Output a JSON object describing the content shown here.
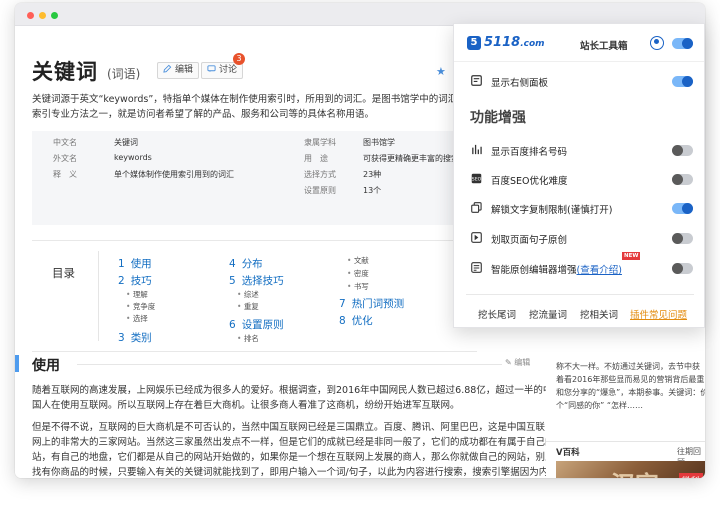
{
  "article": {
    "title": "关键词",
    "title_sub": "(词语)",
    "edit_label": "编辑",
    "discuss_label": "讨论",
    "discuss_count": "3",
    "intro_line1": "关键词源于英文“keywords”，特指单个媒体在制作使用索引时，所用到的词汇。是图书馆学中的词汇。关",
    "intro_line2": "索引专业方法之一，就是访问者希望了解的产品、服务和公司等的具体名称用语。"
  },
  "infobox": {
    "left": [
      {
        "label": "中文名",
        "value": "关键词"
      },
      {
        "label": "外文名",
        "value": "keywords"
      },
      {
        "label": "释　义",
        "value": "单个媒体制作使用索引用到的词汇"
      }
    ],
    "right": [
      {
        "label": "隶属学科",
        "value": "图书馆学"
      },
      {
        "label": "用　途",
        "value": "可获得更精确更丰富的搜索结果"
      },
      {
        "label": "选择方式",
        "value": "23种"
      },
      {
        "label": "设置原则",
        "value": "13个"
      }
    ]
  },
  "toc": {
    "title": "目录",
    "col1": [
      {
        "num": "1",
        "label": "使用"
      },
      {
        "num": "2",
        "label": "技巧"
      },
      {
        "num": "3",
        "label": "类别"
      }
    ],
    "col1_subs": [
      "理解",
      "竞争度",
      "选择"
    ],
    "col2": [
      {
        "num": "4",
        "label": "分布"
      },
      {
        "num": "5",
        "label": "选择技巧"
      },
      {
        "num": "6",
        "label": "设置原则"
      }
    ],
    "col2_subs": [
      "综述",
      "重复"
    ],
    "col2_subs_b": [
      "排名"
    ],
    "col3_subs": [
      "文献",
      "密度",
      "书写"
    ],
    "col3": [
      {
        "num": "7",
        "label": "热门词预测"
      },
      {
        "num": "8",
        "label": "优化"
      }
    ]
  },
  "section": {
    "title": "使用",
    "edit_label": "编辑",
    "para1_line1": "随着互联网的高速发展，上网娱乐已经成为很多人的爱好。根据调查，到2016年中国网民人数已超过6.88亿，超过一半的中",
    "para1_line2": "国人在使用互联网。所以互联网上存在着巨大商机。让很多商人看准了这商机，纷纷开始进军互联网。",
    "para2_line1": "但是不得不说，互联网的巨大商机是不可否认的，当然中国互联网已经是三国鼎立。百度、腾讯、阿里巴巴，这是中国互联",
    "para2_line2": "网上的非常大的三家网站。当然这三家虽然出发点不一样，但是它们的成就已经是非同一般了，它们的成功都在有属于自己的网",
    "para2_line3": "站，有自己的地盘，它们都是从自己的网站开始做的，如果你是一个想在互联网上发展的商人，那么你就做自己的网站，别人在",
    "para2_line4": "找有你商品的时候，只要输入有关的关键词就能找到了，即用户输入一个词/句子，以此为内容进行搜索，搜索引擎据因为内容是"
  },
  "right_col": {
    "line1": "称不大一样。不妨通过关键词，去节中获",
    "line2": "着看2016年那些显而易见的营销背后最重",
    "line3": "和您分享的“爆急”，本期参事。关键词：价",
    "line4": "个“同感的你” “怎样……",
    "vbaike_title": "V百科",
    "vbaike_more": "往期回顾",
    "vbaike_big": "汉字",
    "vbaike_tag": "微科"
  },
  "popup": {
    "logo_text": "5118",
    "logo_domain": ".com",
    "logo_sub": "站长工具箱",
    "show_sidebar_label": "显示右侧面板",
    "section_title": "功能增强",
    "rows": [
      {
        "label": "显示百度排名号码",
        "on": false,
        "icon": "ranking-icon"
      },
      {
        "label": "百度SEO优化难度",
        "on": false,
        "icon": "seo-icon"
      },
      {
        "label": "解锁文字复制限制(谨慎打开)",
        "on": true,
        "icon": "copy-icon"
      },
      {
        "label": "划取页面句子原创",
        "on": false,
        "icon": "select-text-icon"
      },
      {
        "label": "智能原创编辑器增强",
        "on": false,
        "icon": "editor-icon"
      }
    ],
    "view_intro": "(查看介绍)",
    "new_badge": "NEW",
    "footer": [
      "挖长尾词",
      "挖流量词",
      "挖相关词",
      "插件常见问题"
    ]
  },
  "colors": {
    "accent": "#1a62c5",
    "link": "#136ec2",
    "badge": "#e8522c",
    "footer_accent": "#e38b0e"
  }
}
